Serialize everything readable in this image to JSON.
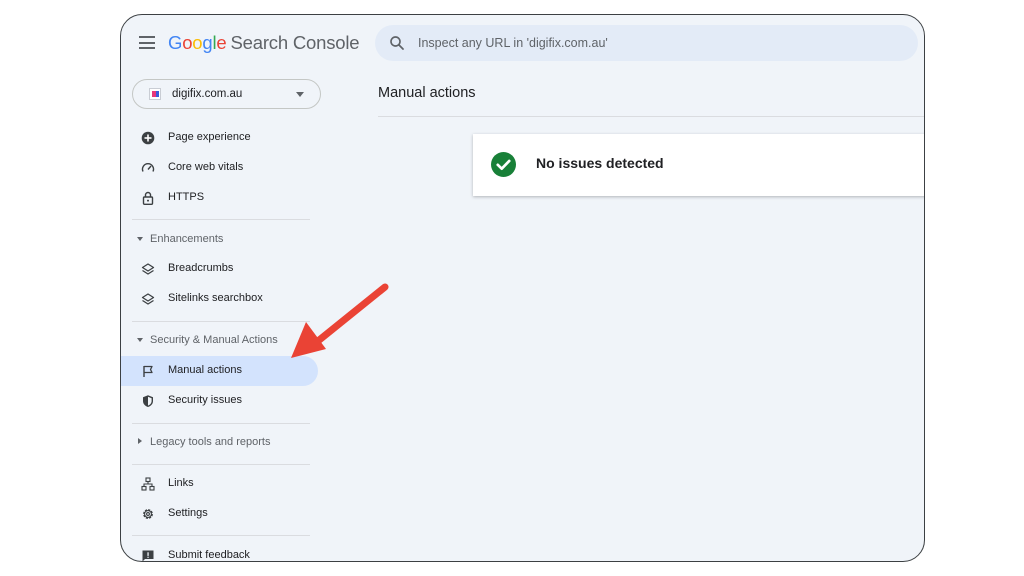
{
  "app": {
    "logo_letters": [
      "G",
      "o",
      "o",
      "g",
      "l",
      "e"
    ],
    "product": "Search Console"
  },
  "search": {
    "placeholder": "Inspect any URL in 'digifix.com.au'"
  },
  "property": {
    "label": "digifix.com.au"
  },
  "sidebar": {
    "items_top": [
      {
        "label": "Page experience",
        "icon": "plus-circle-icon"
      },
      {
        "label": "Core web vitals",
        "icon": "speedometer-icon"
      },
      {
        "label": "HTTPS",
        "icon": "lock-icon"
      }
    ],
    "sections": {
      "enhancements": "Enhancements",
      "security": "Security & Manual Actions",
      "legacy": "Legacy tools and reports"
    },
    "enhancements_items": [
      {
        "label": "Breadcrumbs",
        "icon": "layers-icon"
      },
      {
        "label": "Sitelinks searchbox",
        "icon": "layers-icon"
      }
    ],
    "security_items": [
      {
        "label": "Manual actions",
        "icon": "flag-icon",
        "active": true
      },
      {
        "label": "Security issues",
        "icon": "shield-icon"
      }
    ],
    "bottom_items": [
      {
        "label": "Links",
        "icon": "sitemap-icon"
      },
      {
        "label": "Settings",
        "icon": "gear-icon"
      },
      {
        "label": "Submit feedback",
        "icon": "feedback-icon"
      }
    ]
  },
  "main": {
    "title": "Manual actions",
    "status_text": "No issues detected"
  },
  "colors": {
    "background": "#f0f4f9",
    "active_item": "#d3e3fd",
    "success": "#188038",
    "annotation_arrow": "#ea4335"
  }
}
